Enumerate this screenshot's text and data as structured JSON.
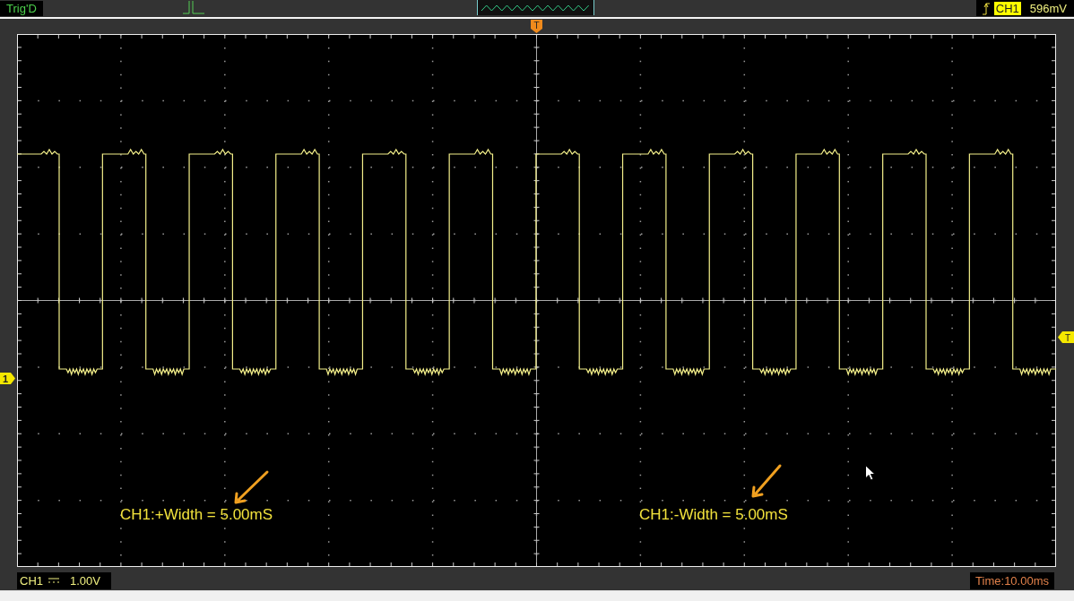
{
  "top_bar": {
    "trigger_status": "Trig'D",
    "trigger_channel": "CH1",
    "trigger_level": "596mV"
  },
  "markers": {
    "trigger_position": "T",
    "channel": "1",
    "trigger_level": "T"
  },
  "annotations": [
    {
      "text": "CH1:+Width = 5.00mS"
    },
    {
      "text": "CH1:-Width = 5.00mS"
    }
  ],
  "bottom_bar": {
    "channel": "CH1",
    "volts_per_div": "1.00V",
    "timebase": "Time:10.00ms"
  }
}
